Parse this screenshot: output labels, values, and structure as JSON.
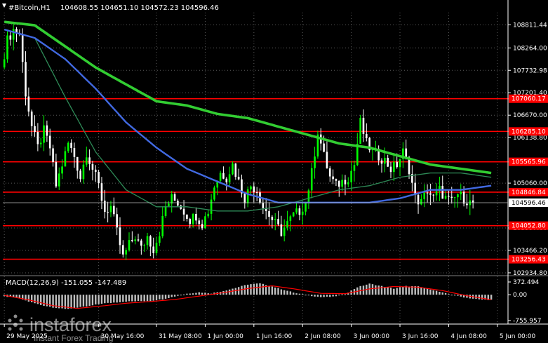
{
  "header": {
    "symbol_label": "#Bitcoin,H1",
    "ohlc": "104608.55 104651.10 104572.23 104596.46"
  },
  "macd": {
    "label": "MACD(12,26,9) -151.055 -147.489",
    "scale": [
      {
        "label": "372.494",
        "value": 372.494
      },
      {
        "label": "0.00",
        "value": 0
      },
      {
        "label": "-755.957",
        "value": -755.957
      }
    ]
  },
  "watermark": {
    "brand": "instaforex",
    "tagline": "Instant Forex Trading"
  },
  "colors": {
    "background": "#000000",
    "grid": "#5a5a5a",
    "bull": "#00ff00",
    "bear": "#ffffff",
    "ma_fast": "#2e8b57",
    "ma_mid": "#4169e1",
    "ma_slow": "#32cd32",
    "level": "#ff0000",
    "macd_hist": "#c0c0c0",
    "macd_signal": "#ff0000",
    "current_price": "#ffffff"
  },
  "chart_data": {
    "type": "candlestick",
    "timeframe": "H1",
    "ylim": [
      102934.0,
      109100.0
    ],
    "y_ticks": [
      {
        "label": "108811.44",
        "value": 108811.44
      },
      {
        "label": "108264.00",
        "value": 108264.0
      },
      {
        "label": "107732.98",
        "value": 107732.98
      },
      {
        "label": "107201.40",
        "value": 107201.4
      },
      {
        "label": "106670.00",
        "value": 106670.0
      },
      {
        "label": "106138.80",
        "value": 106138.8
      },
      {
        "label": "105060.00",
        "value": 105060.0
      },
      {
        "label": "103997.60",
        "value": 103997.6
      },
      {
        "label": "103466.20",
        "value": 103466.2
      },
      {
        "label": "102934.80",
        "value": 102934.8
      }
    ],
    "x_ticks": [
      {
        "label": "29 May 2025",
        "index": 0
      },
      {
        "label": "30 May 16:00",
        "index": 31
      },
      {
        "label": "31 May 08:00",
        "index": 50
      },
      {
        "label": "1 Jun 00:00",
        "index": 66
      },
      {
        "label": "1 Jun 16:00",
        "index": 82
      },
      {
        "label": "2 Jun 08:00",
        "index": 98
      },
      {
        "label": "3 Jun 00:00",
        "index": 114
      },
      {
        "label": "3 Jun 16:00",
        "index": 130
      },
      {
        "label": "4 Jun 08:00",
        "index": 146
      },
      {
        "label": "5 Jun 00:00",
        "index": 162
      }
    ],
    "levels": [
      {
        "label": "107060.17",
        "value": 107060.17
      },
      {
        "label": "106285.10",
        "value": 106285.1
      },
      {
        "label": "105565.96",
        "value": 105565.96
      },
      {
        "label": "104846.84",
        "value": 104846.84
      },
      {
        "label": "104052.80",
        "value": 104052.8
      },
      {
        "label": "103256.43",
        "value": 103256.43
      }
    ],
    "current_price": {
      "label": "104596.46",
      "value": 104596.46
    },
    "price_path": [
      [
        0,
        107800
      ],
      [
        2,
        108450
      ],
      [
        4,
        108700
      ],
      [
        6,
        108600
      ],
      [
        8,
        107200
      ],
      [
        10,
        106400
      ],
      [
        12,
        105900
      ],
      [
        14,
        106300
      ],
      [
        16,
        105900
      ],
      [
        18,
        105000
      ],
      [
        20,
        105500
      ],
      [
        22,
        106000
      ],
      [
        24,
        105700
      ],
      [
        26,
        105200
      ],
      [
        28,
        105800
      ],
      [
        30,
        105400
      ],
      [
        32,
        105000
      ],
      [
        34,
        104400
      ],
      [
        36,
        104500
      ],
      [
        38,
        103900
      ],
      [
        40,
        103300
      ],
      [
        42,
        103600
      ],
      [
        44,
        103800
      ],
      [
        46,
        103500
      ],
      [
        48,
        103800
      ],
      [
        50,
        103500
      ],
      [
        52,
        103900
      ],
      [
        54,
        104500
      ],
      [
        56,
        104700
      ],
      [
        58,
        104600
      ],
      [
        60,
        104400
      ],
      [
        62,
        104200
      ],
      [
        64,
        104300
      ],
      [
        66,
        104100
      ],
      [
        68,
        104400
      ],
      [
        70,
        105000
      ],
      [
        72,
        105300
      ],
      [
        74,
        105200
      ],
      [
        76,
        105500
      ],
      [
        78,
        105100
      ],
      [
        80,
        104700
      ],
      [
        82,
        105000
      ],
      [
        84,
        104900
      ],
      [
        86,
        104500
      ],
      [
        88,
        104300
      ],
      [
        90,
        104100
      ],
      [
        92,
        103900
      ],
      [
        94,
        104100
      ],
      [
        96,
        104300
      ],
      [
        98,
        104400
      ],
      [
        100,
        104600
      ],
      [
        102,
        105300
      ],
      [
        104,
        106300
      ],
      [
        106,
        105700
      ],
      [
        108,
        105200
      ],
      [
        110,
        105000
      ],
      [
        112,
        105100
      ],
      [
        114,
        105200
      ],
      [
        116,
        105500
      ],
      [
        118,
        106500
      ],
      [
        120,
        106000
      ],
      [
        122,
        105800
      ],
      [
        124,
        105700
      ],
      [
        126,
        105600
      ],
      [
        128,
        105400
      ],
      [
        130,
        105500
      ],
      [
        132,
        105800
      ],
      [
        134,
        105400
      ],
      [
        136,
        104700
      ],
      [
        138,
        104600
      ],
      [
        140,
        104900
      ],
      [
        142,
        104700
      ],
      [
        144,
        104900
      ],
      [
        146,
        104700
      ],
      [
        148,
        104600
      ],
      [
        150,
        104800
      ],
      [
        152,
        104700
      ],
      [
        154,
        104596
      ]
    ],
    "series": [
      {
        "color": "ma_fast",
        "values": [
          [
            0,
            108700
          ],
          [
            10,
            108500
          ],
          [
            20,
            107100
          ],
          [
            30,
            105800
          ],
          [
            40,
            104900
          ],
          [
            50,
            104500
          ],
          [
            60,
            104500
          ],
          [
            70,
            104400
          ],
          [
            80,
            104400
          ],
          [
            90,
            104500
          ],
          [
            100,
            104700
          ],
          [
            110,
            104900
          ],
          [
            120,
            105000
          ],
          [
            130,
            105200
          ],
          [
            140,
            105300
          ],
          [
            150,
            105300
          ],
          [
            160,
            105200
          ]
        ]
      },
      {
        "color": "ma_mid",
        "values": [
          [
            0,
            108700
          ],
          [
            10,
            108500
          ],
          [
            20,
            108000
          ],
          [
            30,
            107300
          ],
          [
            40,
            106500
          ],
          [
            50,
            105900
          ],
          [
            60,
            105400
          ],
          [
            70,
            105100
          ],
          [
            80,
            104800
          ],
          [
            90,
            104600
          ],
          [
            100,
            104600
          ],
          [
            110,
            104600
          ],
          [
            120,
            104600
          ],
          [
            130,
            104700
          ],
          [
            140,
            104900
          ],
          [
            150,
            104900
          ],
          [
            160,
            105000
          ]
        ]
      },
      {
        "color": "ma_slow",
        "values": [
          [
            0,
            108880
          ],
          [
            10,
            108800
          ],
          [
            20,
            108300
          ],
          [
            30,
            107800
          ],
          [
            40,
            107400
          ],
          [
            50,
            107000
          ],
          [
            60,
            106900
          ],
          [
            70,
            106700
          ],
          [
            80,
            106600
          ],
          [
            90,
            106400
          ],
          [
            100,
            106200
          ],
          [
            110,
            106000
          ],
          [
            120,
            105900
          ],
          [
            130,
            105700
          ],
          [
            140,
            105500
          ],
          [
            150,
            105400
          ],
          [
            160,
            105300
          ]
        ]
      }
    ],
    "macd_hist": [
      [
        0,
        -50
      ],
      [
        4,
        -80
      ],
      [
        8,
        -200
      ],
      [
        12,
        -300
      ],
      [
        16,
        -370
      ],
      [
        20,
        -420
      ],
      [
        24,
        -380
      ],
      [
        28,
        -330
      ],
      [
        32,
        -260
      ],
      [
        36,
        -230
      ],
      [
        40,
        -200
      ],
      [
        44,
        -190
      ],
      [
        48,
        -180
      ],
      [
        52,
        -130
      ],
      [
        56,
        -50
      ],
      [
        60,
        30
      ],
      [
        64,
        70
      ],
      [
        68,
        40
      ],
      [
        72,
        110
      ],
      [
        76,
        200
      ],
      [
        80,
        300
      ],
      [
        84,
        330
      ],
      [
        88,
        240
      ],
      [
        92,
        140
      ],
      [
        96,
        40
      ],
      [
        100,
        -20
      ],
      [
        104,
        -70
      ],
      [
        108,
        -60
      ],
      [
        112,
        20
      ],
      [
        116,
        220
      ],
      [
        120,
        320
      ],
      [
        124,
        250
      ],
      [
        128,
        180
      ],
      [
        132,
        250
      ],
      [
        136,
        240
      ],
      [
        140,
        160
      ],
      [
        144,
        60
      ],
      [
        148,
        -20
      ],
      [
        152,
        -90
      ],
      [
        156,
        -140
      ],
      [
        160,
        -151
      ]
    ],
    "macd_signal": [
      [
        0,
        -20
      ],
      [
        8,
        -150
      ],
      [
        16,
        -320
      ],
      [
        24,
        -400
      ],
      [
        32,
        -330
      ],
      [
        40,
        -250
      ],
      [
        48,
        -200
      ],
      [
        56,
        -140
      ],
      [
        64,
        -40
      ],
      [
        72,
        60
      ],
      [
        80,
        180
      ],
      [
        88,
        260
      ],
      [
        96,
        160
      ],
      [
        104,
        40
      ],
      [
        112,
        30
      ],
      [
        120,
        170
      ],
      [
        128,
        240
      ],
      [
        136,
        220
      ],
      [
        144,
        120
      ],
      [
        152,
        -30
      ],
      [
        160,
        -147
      ]
    ]
  }
}
